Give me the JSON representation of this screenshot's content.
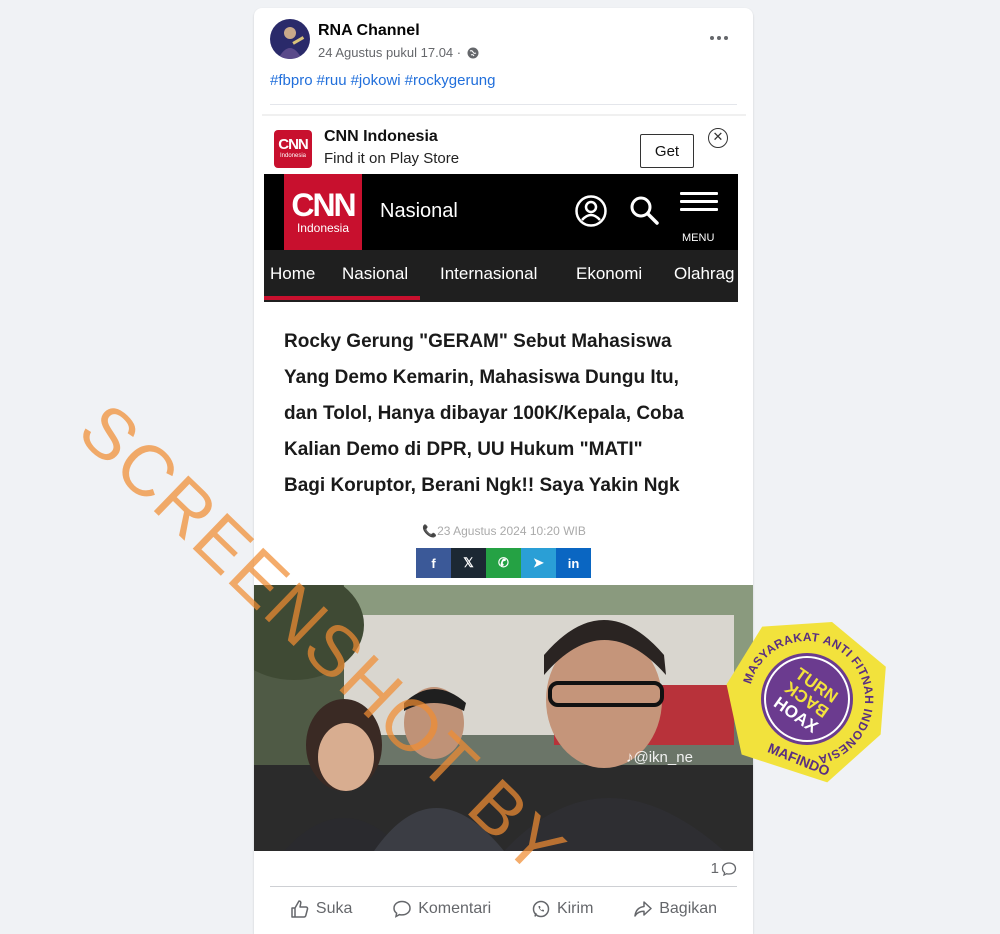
{
  "post": {
    "page_name": "RNA Channel",
    "timestamp": "24 Agustus pukul 17.04 ·",
    "hashtags": [
      "#fbpro",
      "#ruu",
      "#jokowi",
      "#rockygerung"
    ]
  },
  "ad": {
    "title": "CNN Indonesia",
    "subtitle": "Find it on Play Store",
    "get_label": "Get",
    "close_glyph": "✕",
    "logo_big": "CNN",
    "logo_small": "Indonesia"
  },
  "cnn_header": {
    "logo_big": "CNN",
    "logo_small": "Indonesia",
    "section": "Nasional",
    "menu_label": "MENU",
    "nav": [
      "Home",
      "Nasional",
      "Internasional",
      "Ekonomi",
      "Olahrag"
    ]
  },
  "article": {
    "title_lines": [
      "Rocky Gerung \"GERAM\"  Sebut Mahasiswa",
      "Yang Demo Kemarin, Mahasiswa Dungu Itu,",
      "dan Tolol, Hanya dibayar 100K/Kepala, Coba",
      "Kalian Demo di DPR, UU Hukum \"MATI\"",
      "Bagi Koruptor, Berani Ngk!! Saya Yakin Ngk"
    ],
    "date": "📞23 Agustus 2024 10:20 WIB",
    "share": [
      {
        "label": "f",
        "color": "#3b5998"
      },
      {
        "label": "𝕏",
        "color": "#1c2833"
      },
      {
        "label": "✆",
        "color": "#25a244"
      },
      {
        "label": "➤",
        "color": "#2a9fd6"
      },
      {
        "label": "in",
        "color": "#0a66c2"
      }
    ]
  },
  "photo": {
    "tag": "♪@ikn_ne"
  },
  "footer": {
    "comment_count": "1",
    "actions": {
      "like": "Suka",
      "comment": "Komentari",
      "send": "Kirim",
      "share": "Bagikan"
    }
  },
  "overlay": {
    "watermark": "SCREENSHOT BY",
    "badge_ring": "MASYARAKAT ANTI FITNAH INDONESIA",
    "badge_bottom": "MAFINDO",
    "badge_center_1": "TURN",
    "badge_center_2": "BACK",
    "badge_center_3": "HOAX",
    "watermark_color": "#f08c32",
    "badge_color": "#f2e23c"
  }
}
